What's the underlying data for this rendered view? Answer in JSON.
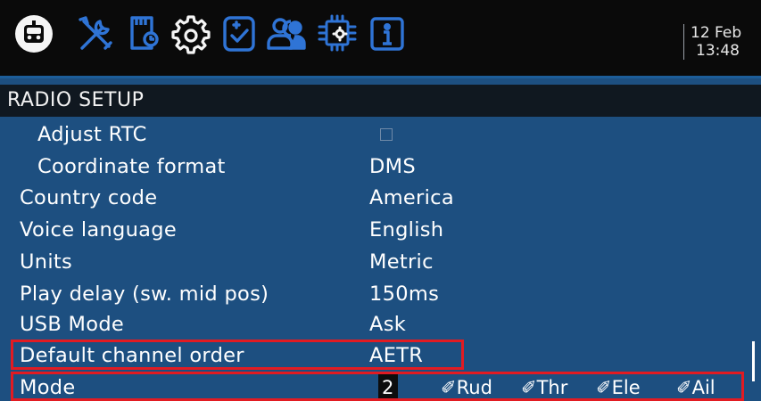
{
  "colors": {
    "topbar_bg": "#0a0a0a",
    "screen_bg": "#1d4f80",
    "header_bg": "#101820",
    "icon_blue": "#2f74d6",
    "highlight_red": "#e21b22",
    "text": "#ffffff"
  },
  "topbar": {
    "icons": [
      "radio-menu-icon",
      "tools-icon",
      "sd-card-icon",
      "settings-gear-icon",
      "checklist-icon",
      "users-icon",
      "hardware-chip-icon",
      "info-icon"
    ],
    "date": "12 Feb",
    "time": "13:48"
  },
  "header": {
    "title": "RADIO SETUP"
  },
  "rows": [
    {
      "label": "Adjust RTC",
      "value": ""
    },
    {
      "label": "Coordinate format",
      "value": "DMS"
    },
    {
      "label": "Country code",
      "value": "America"
    },
    {
      "label": "Voice language",
      "value": "English"
    },
    {
      "label": "Units",
      "value": "Metric"
    },
    {
      "label": "Play delay (sw. mid pos)",
      "value": "150ms"
    },
    {
      "label": "USB Mode",
      "value": "Ask"
    },
    {
      "label": "Default channel order",
      "value": "AETR"
    },
    {
      "label": "Mode",
      "value": "2"
    }
  ],
  "mode_sticks": [
    "Rud",
    "Thr",
    "Ele",
    "Ail"
  ]
}
